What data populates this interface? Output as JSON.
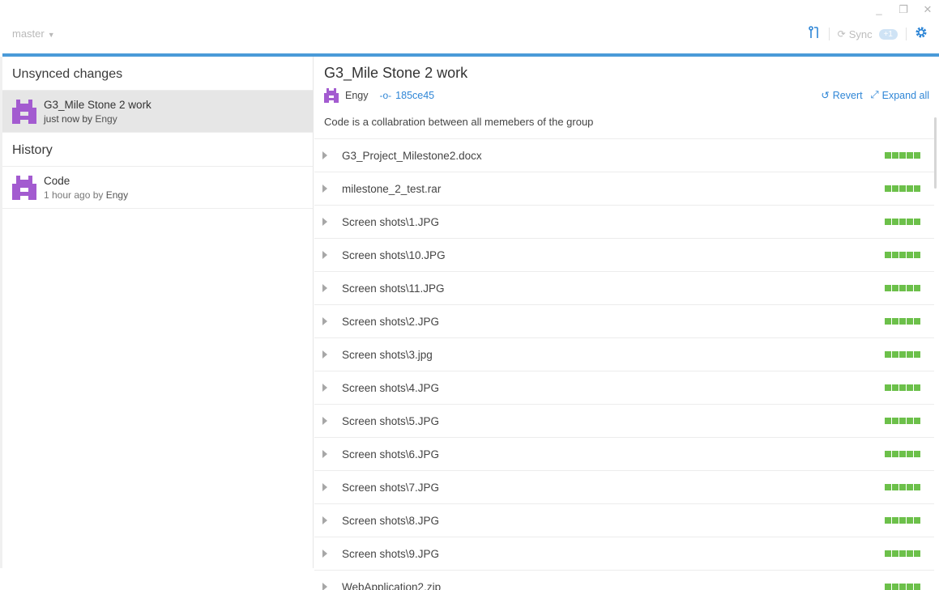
{
  "window": {
    "minimize_glyph": "_",
    "restore_glyph": "❐",
    "close_glyph": "✕"
  },
  "toolbar": {
    "branch": "master",
    "sync_label": "Sync",
    "sync_badge": "+1",
    "icons": [
      "pull-request-icon",
      "sync-icon",
      "gear-icon"
    ]
  },
  "left": {
    "unsynced_title": "Unsynced changes",
    "unsynced": [
      {
        "message": "G3_Mile Stone 2 work",
        "time": "just now by",
        "author": "Engy"
      }
    ],
    "history_title": "History",
    "history": [
      {
        "message": "Code",
        "time": "1 hour ago by",
        "author": "Engy"
      }
    ]
  },
  "detail": {
    "title": "G3_Mile Stone 2 work",
    "author": "Engy",
    "sha": "185ce45",
    "revert_label": "Revert",
    "expand_label": "Expand all",
    "description": "Code is a collabration between all memebers of the group",
    "files": [
      "G3_Project_Milestone2.docx",
      "milestone_2_test.rar",
      "Screen shots\\1.JPG",
      "Screen shots\\10.JPG",
      "Screen shots\\11.JPG",
      "Screen shots\\2.JPG",
      "Screen shots\\3.jpg",
      "Screen shots\\4.JPG",
      "Screen shots\\5.JPG",
      "Screen shots\\6.JPG",
      "Screen shots\\7.JPG",
      "Screen shots\\8.JPG",
      "Screen shots\\9.JPG",
      "WebApplication2.zip"
    ]
  },
  "colors": {
    "accent": "#4a9ad8",
    "link": "#2f86d6",
    "diff_added": "#6cc04a",
    "avatar": "#a35bd0"
  }
}
